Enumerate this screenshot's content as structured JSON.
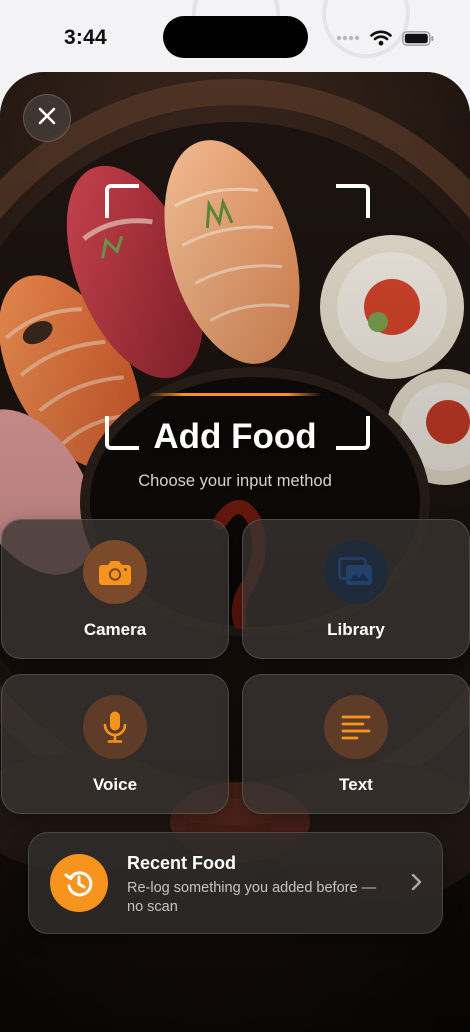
{
  "status_bar": {
    "time": "3:44",
    "icons": [
      "signal-dots-icon",
      "wifi-icon",
      "battery-icon"
    ]
  },
  "sheet": {
    "close_icon": "close-icon",
    "title": "Add Food",
    "subtitle": "Choose your input method",
    "accent_color": "#f7941d",
    "options": [
      {
        "label": "Camera",
        "icon": "camera-icon"
      },
      {
        "label": "Library",
        "icon": "photo-library-icon"
      },
      {
        "label": "Voice",
        "icon": "microphone-icon"
      },
      {
        "label": "Text",
        "icon": "text-lines-icon"
      }
    ],
    "recent": {
      "title": "Recent Food",
      "description": "Re-log something you added before — no scan",
      "icon": "history-icon"
    }
  }
}
